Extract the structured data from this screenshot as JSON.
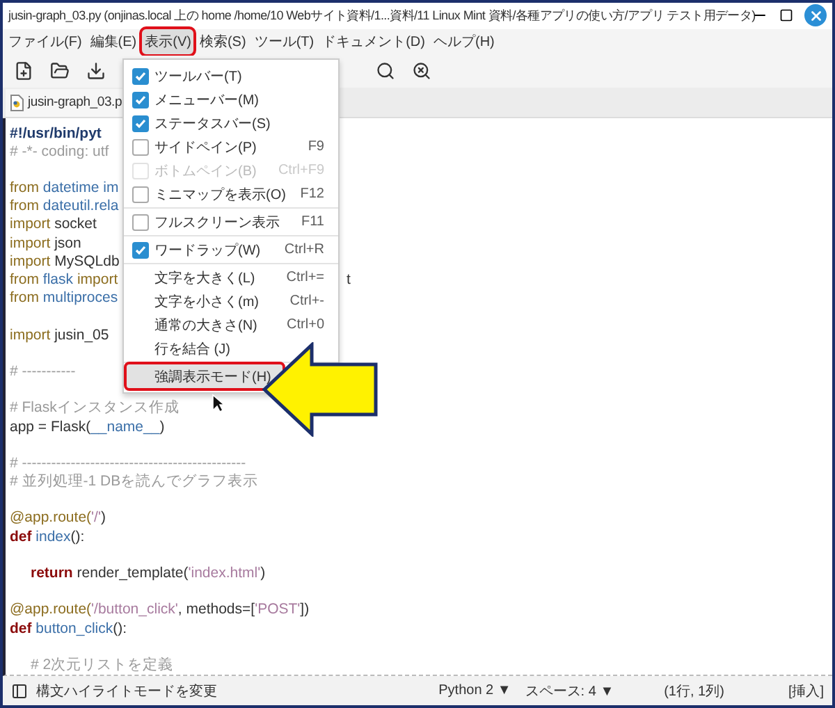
{
  "window": {
    "title": "jusin-graph_03.py (onjinas.local 上の home /home/10 Webサイト資料/1...資料/11 Linux Mint 資料/各種アプリの使い方/アプリ テスト用データ)"
  },
  "menubar": [
    {
      "label": "ファイル(F)",
      "selected": false
    },
    {
      "label": "編集(E)",
      "selected": false
    },
    {
      "label": "表示(V)",
      "selected": true
    },
    {
      "label": "検索(S)",
      "selected": false
    },
    {
      "label": "ツール(T)",
      "selected": false
    },
    {
      "label": "ドキュメント(D)",
      "selected": false
    },
    {
      "label": "ヘルプ(H)",
      "selected": false
    }
  ],
  "tab": {
    "label": "jusin-graph_03.p"
  },
  "code_lines": [
    {
      "tokens": [
        {
          "t": "#!/usr/bin/pyt",
          "kind": "shebang"
        }
      ]
    },
    {
      "blank_after": true,
      "tokens": [
        {
          "t": "# -*- coding: utf",
          "kind": "comment"
        }
      ]
    },
    {
      "tokens": [
        {
          "t": "from ",
          "kind": "keyword"
        },
        {
          "t": "datetime im",
          "kind": "name"
        }
      ]
    },
    {
      "tokens": [
        {
          "t": "from ",
          "kind": "keyword"
        },
        {
          "t": "dateutil.rela",
          "kind": "name"
        }
      ]
    },
    {
      "tokens": [
        {
          "t": "import ",
          "kind": "keyword"
        },
        {
          "t": "socket",
          "kind": "plain"
        }
      ]
    },
    {
      "tokens": [
        {
          "t": "import ",
          "kind": "keyword"
        },
        {
          "t": "json",
          "kind": "plain"
        }
      ]
    },
    {
      "tokens": [
        {
          "t": "import ",
          "kind": "keyword"
        },
        {
          "t": "MySQLdb",
          "kind": "plain"
        }
      ]
    },
    {
      "tokens": [
        {
          "t": "from ",
          "kind": "keyword"
        },
        {
          "t": "flask ",
          "kind": "name"
        },
        {
          "t": "import",
          "kind": "keyword"
        }
      ],
      "tail": "t"
    },
    {
      "blank_after": true,
      "tokens": [
        {
          "t": "from ",
          "kind": "keyword"
        },
        {
          "t": "multiproces",
          "kind": "name"
        }
      ]
    },
    {
      "blank_after": true,
      "tokens": [
        {
          "t": "import ",
          "kind": "keyword"
        },
        {
          "t": "jusin_05",
          "kind": "plain"
        }
      ]
    },
    {
      "blank_after": true,
      "tokens": [
        {
          "t": "# -----------",
          "kind": "comment"
        }
      ]
    },
    {
      "tokens": [
        {
          "t": "# Flaskインスタンス作成",
          "kind": "comment"
        }
      ]
    },
    {
      "blank_after": true,
      "tokens": [
        {
          "t": "app = Flask(",
          "kind": "plain"
        },
        {
          "t": "__name__",
          "kind": "name"
        },
        {
          "t": ")",
          "kind": "plain"
        }
      ]
    },
    {
      "tokens": [
        {
          "t": "# ----------------------------------------------",
          "kind": "comment"
        }
      ]
    },
    {
      "blank_after": true,
      "tokens": [
        {
          "t": "# 並列処理-1 DBを読んでグラフ表示",
          "kind": "comment"
        }
      ]
    },
    {
      "tokens": [
        {
          "t": "@app.route(",
          "kind": "keyword"
        },
        {
          "t": "'/'",
          "kind": "string"
        },
        {
          "t": ")",
          "kind": "plain"
        }
      ]
    },
    {
      "blank_after": true,
      "tokens": [
        {
          "t": "def ",
          "kind": "def"
        },
        {
          "t": "index",
          "kind": "name"
        },
        {
          "t": "():",
          "kind": "plain"
        }
      ]
    },
    {
      "blank_after": true,
      "indent": true,
      "tokens": [
        {
          "t": "return ",
          "kind": "def"
        },
        {
          "t": "render_template(",
          "kind": "plain"
        },
        {
          "t": "'index.html'",
          "kind": "string"
        },
        {
          "t": ")",
          "kind": "plain"
        }
      ]
    },
    {
      "tokens": [
        {
          "t": "@app.route(",
          "kind": "keyword"
        },
        {
          "t": "'/button_click'",
          "kind": "string"
        },
        {
          "t": ", methods=[",
          "kind": "plain"
        },
        {
          "t": "'POST'",
          "kind": "string"
        },
        {
          "t": "])",
          "kind": "plain"
        }
      ]
    },
    {
      "blank_after": true,
      "tokens": [
        {
          "t": "def ",
          "kind": "def"
        },
        {
          "t": "button_click",
          "kind": "name"
        },
        {
          "t": "():",
          "kind": "plain"
        }
      ]
    },
    {
      "indent": true,
      "tokens": [
        {
          "t": "# 2次元リストを定義",
          "kind": "comment"
        }
      ]
    }
  ],
  "view_menu": [
    {
      "kind": "check",
      "label": "ツールバー(T)",
      "checked": true,
      "disabled": false,
      "selected": false
    },
    {
      "kind": "check",
      "label": "メニューバー(M)",
      "checked": true,
      "disabled": false,
      "selected": false
    },
    {
      "kind": "check",
      "label": "ステータスバー(S)",
      "checked": true,
      "disabled": false,
      "selected": false
    },
    {
      "kind": "check",
      "label": "サイドペイン(P)",
      "shortcut": "F9",
      "checked": false,
      "disabled": false,
      "selected": false
    },
    {
      "kind": "check",
      "label": "ボトムペイン(B)",
      "shortcut": "Ctrl+F9",
      "checked": false,
      "disabled": true,
      "selected": false
    },
    {
      "kind": "check",
      "label": "ミニマップを表示(O)",
      "shortcut": "F12",
      "checked": false,
      "disabled": false,
      "selected": false
    },
    {
      "kind": "separator"
    },
    {
      "kind": "check",
      "label": "フルスクリーン表示",
      "shortcut": "F11",
      "checked": false,
      "disabled": false,
      "selected": false
    },
    {
      "kind": "separator"
    },
    {
      "kind": "check",
      "label": "ワードラップ(W)",
      "shortcut": "Ctrl+R",
      "checked": true,
      "disabled": false,
      "selected": false
    },
    {
      "kind": "separator"
    },
    {
      "kind": "plain",
      "label": "文字を大きく(L)",
      "shortcut": "Ctrl+=",
      "disabled": false,
      "selected": false
    },
    {
      "kind": "plain",
      "label": "文字を小さく(m)",
      "shortcut": "Ctrl+-",
      "disabled": false,
      "selected": false
    },
    {
      "kind": "plain",
      "label": "通常の大きさ(N)",
      "shortcut": "Ctrl+0",
      "disabled": false,
      "selected": false
    },
    {
      "kind": "plain",
      "label": "行を結合 (J)",
      "disabled": false,
      "selected": false
    },
    {
      "kind": "separator"
    },
    {
      "kind": "plain",
      "label": "強調表示モード(H)",
      "disabled": false,
      "selected": true
    }
  ],
  "status_bar": {
    "message": "構文ハイライトモードを変更",
    "language": "Python 2 ▼",
    "indent": "スペース: 4 ▼",
    "position": "(1行, 1列)",
    "mode": "[挿入]"
  }
}
